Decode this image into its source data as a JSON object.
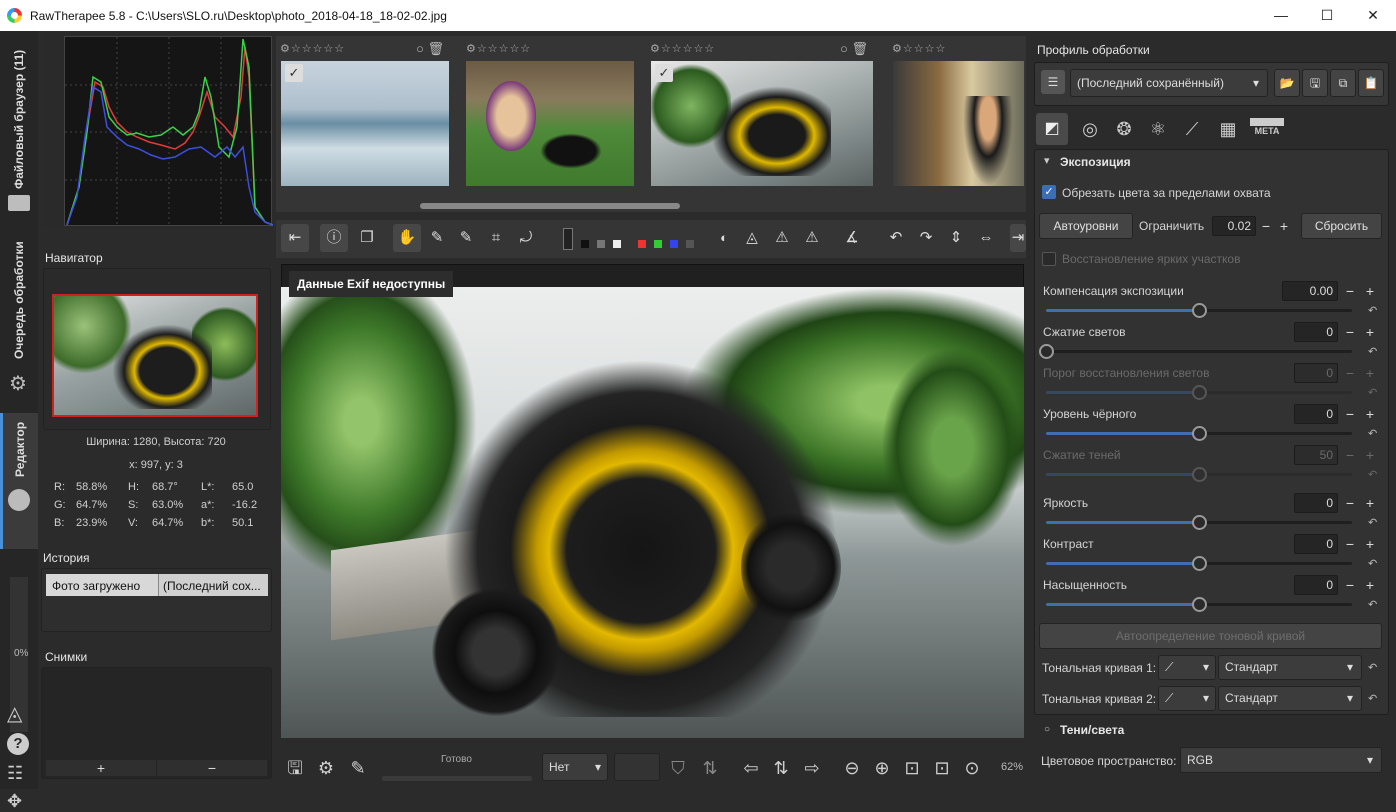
{
  "window": {
    "title": "RawTherapee 5.8 - C:\\Users\\SLO.ru\\Desktop\\photo_2018-04-18_18-02-02.jpg",
    "min": "—",
    "max": "☐",
    "close": "✕"
  },
  "left_tabs": {
    "file_browser": "Файловый браузер (11)",
    "queue": "Очередь обработки",
    "editor": "Редактор"
  },
  "histogram": {
    "colors": {
      "r": "#e23b3b",
      "g": "#3bd14a",
      "b": "#3b4fe2",
      "w": "#c8c8c8"
    }
  },
  "navigator": {
    "title": "Навигатор",
    "size": "Ширина: 1280, Высота: 720",
    "coords": "x: 997, y: 3",
    "r_lbl": "R:",
    "r": "58.8%",
    "g_lbl": "G:",
    "g": "64.7%",
    "b_lbl": "B:",
    "b": "23.9%",
    "h_lbl": "H:",
    "h": "68.7°",
    "s_lbl": "S:",
    "s": "63.0%",
    "v_lbl": "V:",
    "v": "64.7%",
    "l_lbl": "L*:",
    "l": "65.0",
    "a_lbl": "a*:",
    "a": "-16.2",
    "bb_lbl": "b*:",
    "bb": "50.1"
  },
  "history": {
    "title": "История",
    "col1": "Фото загружено",
    "col2": "(Последний сох..."
  },
  "snapshots": {
    "title": "Снимки",
    "add": "+",
    "remove": "−"
  },
  "progress": "0%",
  "viewer": {
    "exif": "Данные Exif недоступны",
    "status": "Готово",
    "zoom": "62%",
    "preview": "Нет"
  },
  "right": {
    "profile_title": "Профиль обработки",
    "profile_value": "(Последний сохранённый)",
    "exposure_title": "Экспозиция",
    "clip_label": "Обрезать цвета за пределами охвата",
    "auto_levels": "Автоуровни",
    "clip_limit_label": "Ограничить",
    "clip_limit": "0.02",
    "reset": "Сбросить",
    "highlight_recovery": "Восстановление ярких участков",
    "sliders": [
      {
        "label": "Компенсация экспозиции",
        "value": "0.00",
        "pos": 0.5,
        "enabled": true
      },
      {
        "label": "Сжатие светов",
        "value": "0",
        "pos": 0.0,
        "enabled": true
      },
      {
        "label": "Порог восстановления светов",
        "value": "0",
        "pos": 0.5,
        "enabled": false
      },
      {
        "label": "Уровень чёрного",
        "value": "0",
        "pos": 0.5,
        "enabled": true
      },
      {
        "label": "Сжатие теней",
        "value": "50",
        "pos": 0.5,
        "enabled": false
      },
      {
        "label": "Яркость",
        "value": "0",
        "pos": 0.5,
        "enabled": true
      },
      {
        "label": "Контраст",
        "value": "0",
        "pos": 0.5,
        "enabled": true
      },
      {
        "label": "Насыщенность",
        "value": "0",
        "pos": 0.5,
        "enabled": true
      }
    ],
    "auto_tone": "Автоопределение тоновой кривой",
    "curve1_label": "Тональная кривая 1:",
    "curve2_label": "Тональная кривая 2:",
    "curve_mode": "Стандарт",
    "shadows_title": "Тени/света",
    "colorspace_label": "Цветовое пространство:",
    "colorspace": "RGB",
    "meta": "META"
  }
}
